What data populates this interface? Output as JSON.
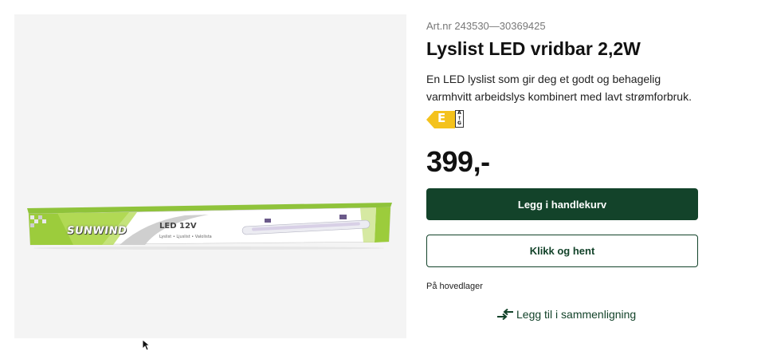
{
  "product_image": {
    "brand": "SUNWIND",
    "model": "LED 12V",
    "subtitle": "Lyslist • Ljuslist • Valolista"
  },
  "product": {
    "article_number": "Art.nr 243530—30369425",
    "title": "Lyslist LED vridbar 2,2W",
    "description": "En LED lyslist som gir deg et godt og behagelig varmhvitt arbeidslys kombinert med lavt strømforbruk.",
    "price": "399,-"
  },
  "energy_label": {
    "class": "E",
    "scale_top": "A",
    "scale_arrow": "↑",
    "scale_bottom": "G",
    "color": "#f4c21c"
  },
  "actions": {
    "add_to_cart": "Legg i handlekurv",
    "click_and_collect": "Klikk og hent",
    "compare": "Legg til i sammenligning"
  },
  "stock": {
    "status": "På hovedlager"
  },
  "colors": {
    "primary": "#13432a",
    "image_background": "#f4f4f4"
  },
  "icons": {
    "compare": "compare-arrows-icon",
    "cursor": "mouse-cursor-icon"
  }
}
